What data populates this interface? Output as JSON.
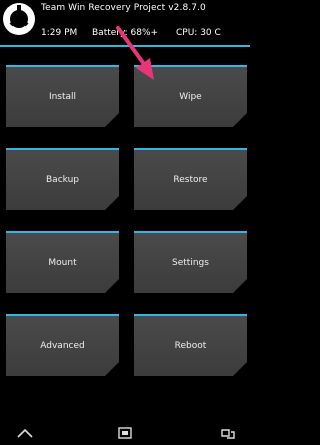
{
  "header": {
    "title": "Team Win Recovery Project  v2.8.7.0",
    "time": "1:29 PM",
    "battery": "Battery: 68%+",
    "cpu": "CPU: 30 C"
  },
  "menu": {
    "install": "Install",
    "wipe": "Wipe",
    "backup": "Backup",
    "restore": "Restore",
    "mount": "Mount",
    "settings": "Settings",
    "advanced": "Advanced",
    "reboot": "Reboot"
  },
  "colors": {
    "accent": "#33b5e5",
    "tile": "#444444",
    "annotation_arrow": "#e8357a"
  },
  "icons": {
    "logo": "twrp-logo-icon",
    "back": "back-icon",
    "home": "home-icon",
    "recent": "recent-apps-icon"
  }
}
